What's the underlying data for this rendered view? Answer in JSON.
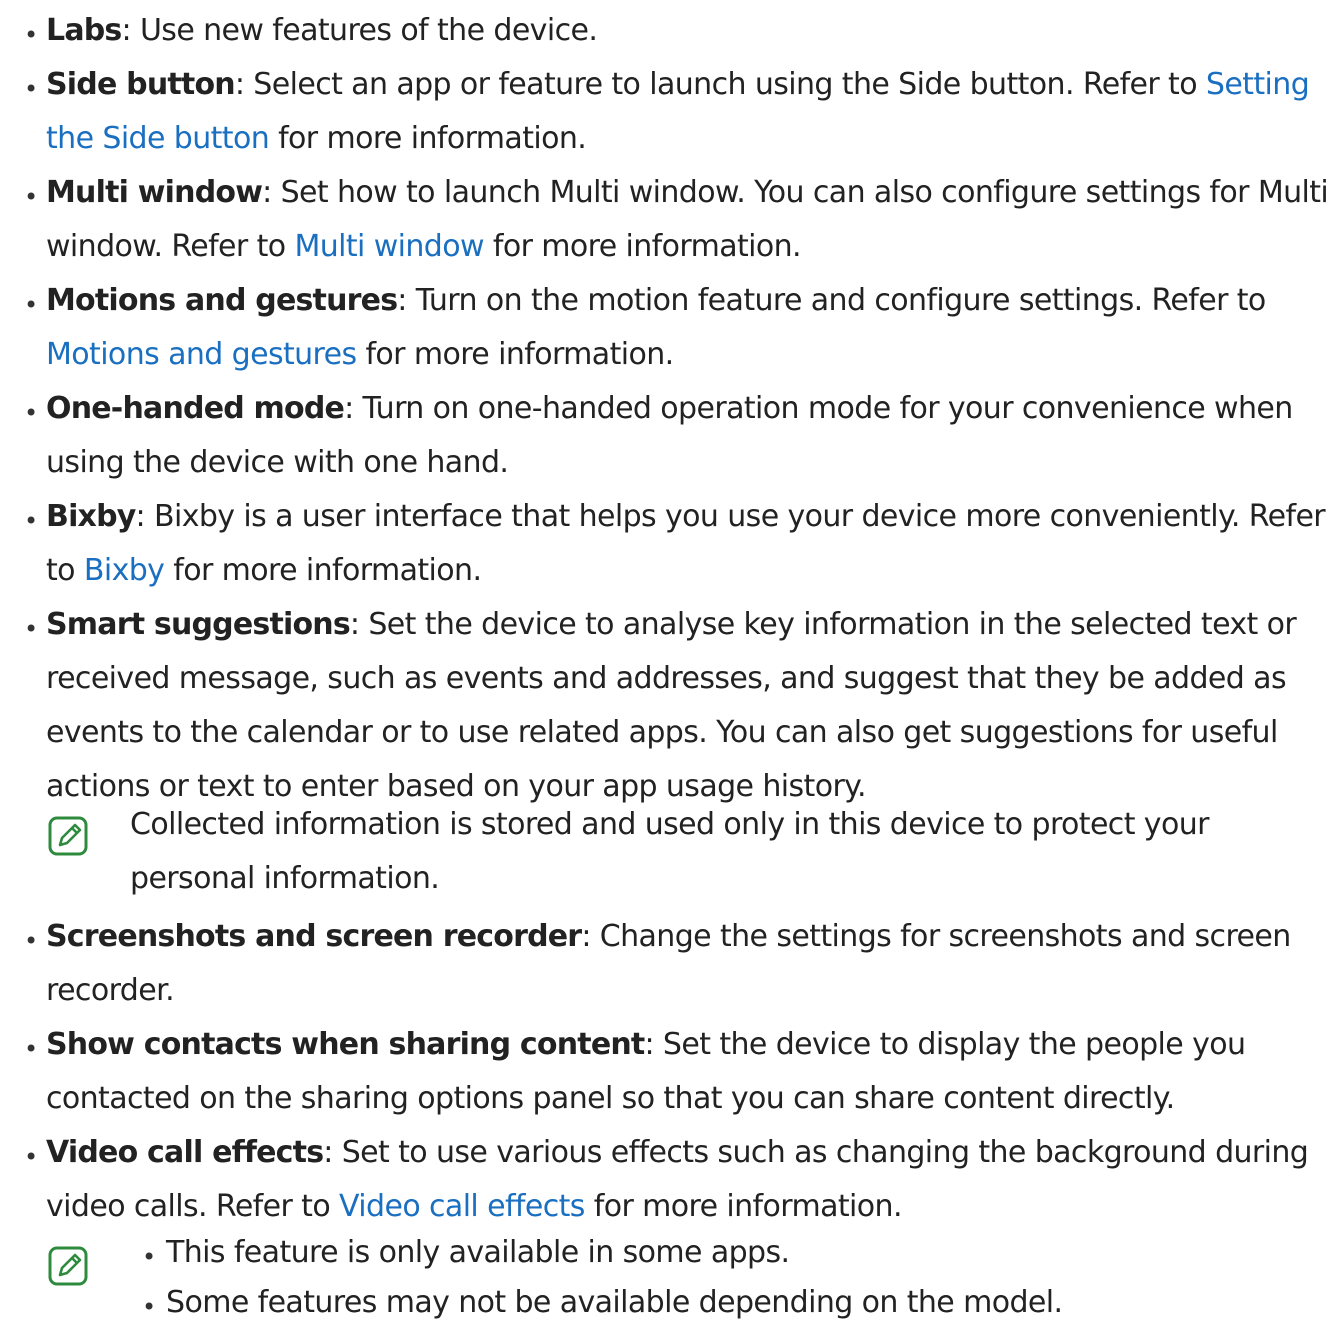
{
  "items": [
    {
      "term": "Labs",
      "sep": ": ",
      "text": "Use new features of the device."
    },
    {
      "term": "Side button",
      "sep": ": ",
      "text": "Select an app or feature to launch using the Side button. Refer to ",
      "link": "Setting the Side button",
      "tail": " for more information."
    },
    {
      "term": "Multi window",
      "sep": ": ",
      "text": "Set how to launch Multi window. You can also configure settings for Multi window. Refer to ",
      "link": "Multi window",
      "tail": " for more information."
    },
    {
      "term": "Motions and gestures",
      "sep": ": ",
      "text": "Turn on the motion feature and configure settings. Refer to ",
      "link": "Motions and gestures",
      "tail": " for more information."
    },
    {
      "term": "One-handed mode",
      "sep": ": ",
      "text": "Turn on one-handed operation mode for your convenience when using the device with one hand."
    },
    {
      "term": "Bixby",
      "sep": ": ",
      "text": "Bixby is a user interface that helps you use your device more conveniently. Refer to ",
      "link": "Bixby",
      "tail": " for more information."
    },
    {
      "term": "Smart suggestions",
      "sep": ": ",
      "text": "Set the device to analyse key information in the selected text or received message, such as events and addresses, and suggest that they be added as events to the calendar or to use related apps. You can also get suggestions for useful actions or text to enter based on your app usage history."
    },
    {
      "term": "Screenshots and screen recorder",
      "sep": ": ",
      "text": "Change the settings for screenshots and screen recorder."
    },
    {
      "term": "Show contacts when sharing content",
      "sep": ": ",
      "text": "Set the device to display the people you contacted on the sharing options panel so that you can share content directly."
    },
    {
      "term": "Video call effects",
      "sep": ": ",
      "text": "Set to use various effects such as changing the background during video calls. Refer to ",
      "link": "Video call effects",
      "tail": " for more information."
    }
  ],
  "note1": "Collected information is stored and used only in this device to protect your personal information.",
  "note2": [
    "This feature is only available in some apps.",
    "Some features may not be available depending on the model."
  ],
  "bullet_char": "•",
  "icon": "note-pencil-icon",
  "colors": {
    "text": "#222222",
    "link": "#1a6fc0",
    "icon": "#2e8b3e"
  }
}
